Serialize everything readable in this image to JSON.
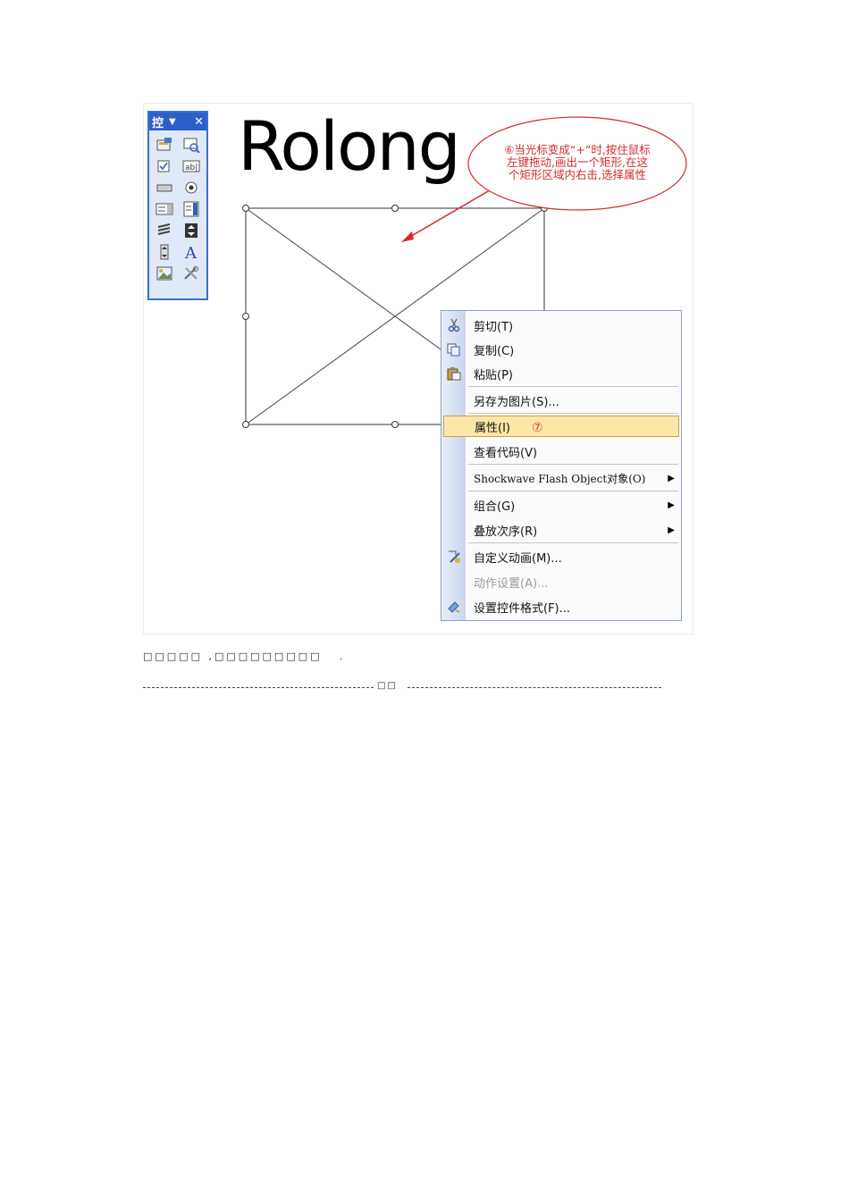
{
  "toolbox": {
    "title": "控",
    "dropdown_icon": "chevron-down-icon",
    "close_icon": "close-icon",
    "buttons": [
      {
        "name": "more-controls-icon"
      },
      {
        "name": "view-code-icon"
      },
      {
        "name": "checkbox-icon"
      },
      {
        "name": "textbox-icon"
      },
      {
        "name": "command-button-icon"
      },
      {
        "name": "option-button-icon"
      },
      {
        "name": "listbox-icon"
      },
      {
        "name": "combobox-icon"
      },
      {
        "name": "toggle-button-icon"
      },
      {
        "name": "spin-button-icon"
      },
      {
        "name": "scrollbar-icon"
      },
      {
        "name": "label-icon"
      },
      {
        "name": "image-icon"
      },
      {
        "name": "more-tools-icon"
      }
    ],
    "label_glyph": "A"
  },
  "heading": "Rolong",
  "callout": {
    "lines": [
      "⑥当光标变成“+”时,按住鼠标",
      "左键拖动,画出一个矩形,在这",
      "个矩形区域内右击,选择属性"
    ],
    "color": "#d42b2b"
  },
  "menu": {
    "items": [
      {
        "label": "剪切(T)",
        "icon": "cut-icon"
      },
      {
        "label": "复制(C)",
        "icon": "copy-icon"
      },
      {
        "label": "粘贴(P)",
        "icon": "paste-icon"
      },
      {
        "label": "另存为图片(S)..."
      },
      {
        "label": "属性(I)",
        "highlighted": true,
        "marker": "⑦"
      },
      {
        "label": "查看代码(V)"
      },
      {
        "label": "Shockwave Flash Object对象(O)",
        "submenu": true
      },
      {
        "label": "组合(G)",
        "submenu": true
      },
      {
        "label": "叠放次序(R)",
        "submenu": true
      },
      {
        "label": "自定义动画(M)...",
        "icon": "custom-animation-icon"
      },
      {
        "label": "动作设置(A)...",
        "disabled": true
      },
      {
        "label": "设置控件格式(F)...",
        "icon": "format-control-icon"
      }
    ],
    "highlight_color": "#fde7a8"
  },
  "caption": {
    "left": "□□□□□ ,□□□□□□□□□",
    "right": "."
  },
  "divider": {
    "label": "□□"
  }
}
